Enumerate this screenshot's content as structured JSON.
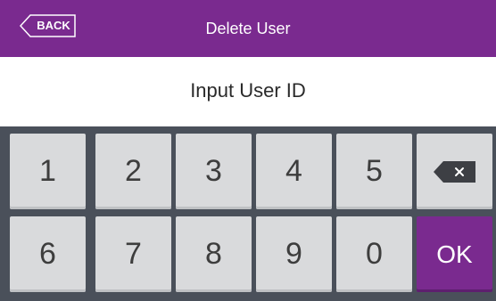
{
  "header": {
    "back_label": "BACK",
    "title": "Delete User"
  },
  "prompt": "Input User ID",
  "keypad": {
    "row1": [
      "1",
      "2",
      "3",
      "4",
      "5"
    ],
    "row2": [
      "6",
      "7",
      "8",
      "9",
      "0"
    ],
    "ok_label": "OK",
    "backspace_icon": "backspace-icon"
  },
  "colors": {
    "accent": "#7a2a8f",
    "keypad_bg": "#4a505a",
    "key_bg": "#d9dadc"
  }
}
